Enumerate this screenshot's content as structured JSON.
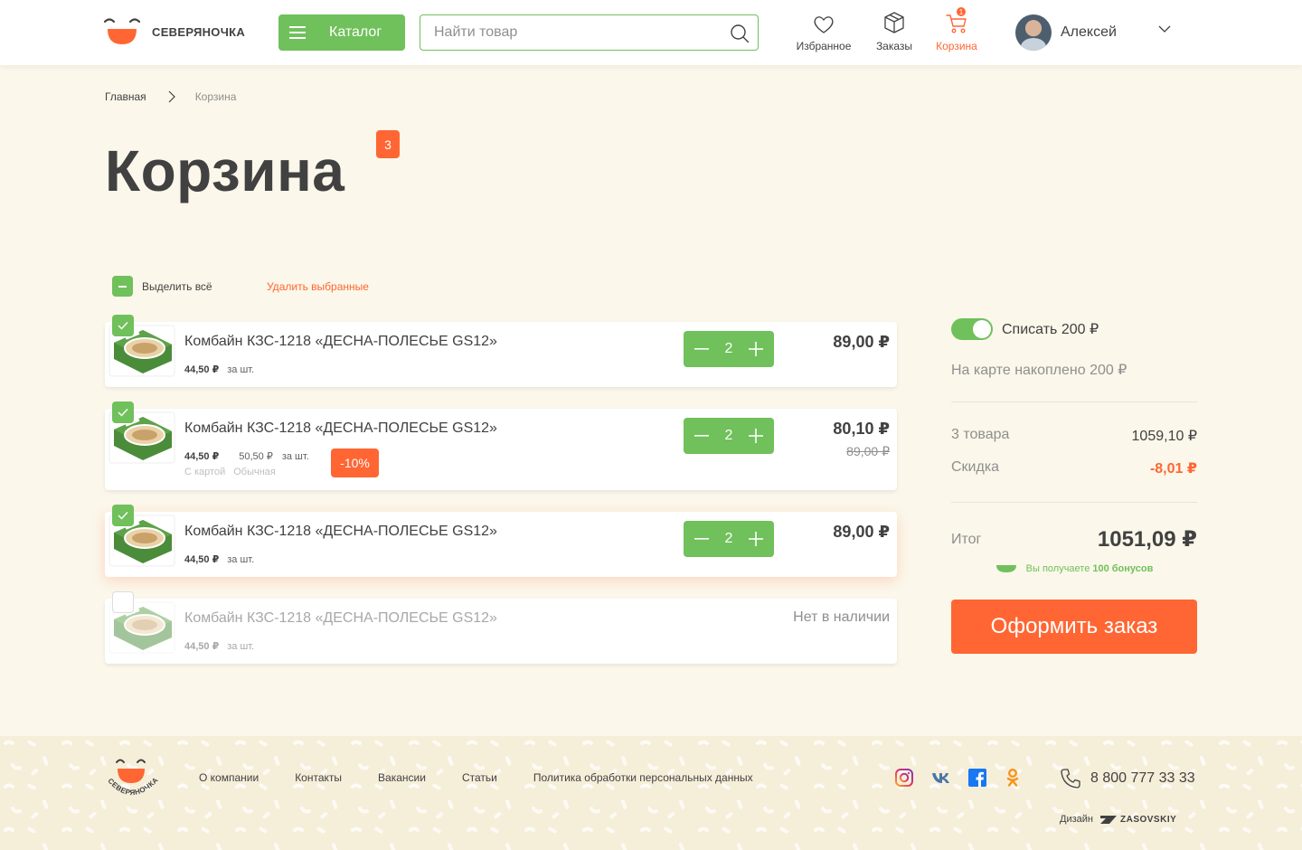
{
  "header": {
    "logo_text": "СЕВЕРЯНОЧКА",
    "catalog_label": "Каталог",
    "search_placeholder": "Найти товар",
    "nav": {
      "favorites": "Избранное",
      "orders": "Заказы",
      "cart": "Корзина",
      "cart_count": "1"
    },
    "user_name": "Алексей"
  },
  "breadcrumb": {
    "home": "Главная",
    "current": "Корзина"
  },
  "page": {
    "title": "Корзина",
    "count": "3"
  },
  "selection": {
    "select_all": "Выделить всё",
    "delete_selected": "Удалить выбранные"
  },
  "items": [
    {
      "name": "Комбайн КЗС-1218 «ДЕСНА-ПОЛЕСЬЕ GS12»",
      "price": "44,50 ₽",
      "per": "за шт.",
      "qty": "2",
      "total": "89,00 ₽",
      "checked": true
    },
    {
      "name": "Комбайн КЗС-1218 «ДЕСНА-ПОЛЕСЬЕ GS12»",
      "price": "44,50 ₽",
      "price_regular": "50,50 ₽",
      "per": "за шт.",
      "label_card": "С картой",
      "label_regular": "Обычная",
      "discount": "-10%",
      "qty": "2",
      "total": "80,10 ₽",
      "old_total": "89,00 ₽",
      "checked": true
    },
    {
      "name": "Комбайн КЗС-1218 «ДЕСНА-ПОЛЕСЬЕ GS12»",
      "price": "44,50 ₽",
      "per": "за шт.",
      "qty": "2",
      "total": "89,00 ₽",
      "checked": true
    },
    {
      "name": "Комбайн КЗС-1218 «ДЕСНА-ПОЛЕСЬЕ GS12»",
      "price": "44,50 ₽",
      "per": "за шт.",
      "status": "Нет в наличии",
      "checked": false
    }
  ],
  "summary": {
    "toggle_label": "Списать 200 ₽",
    "accumulated": "На карте накоплено 200 ₽",
    "goods_label": "3 товара",
    "goods_value": "1059,10 ₽",
    "discount_label": "Скидка",
    "discount_value": "-8,01 ₽",
    "total_label": "Итог",
    "total_value": "1051,09 ₽",
    "bonus_text": "Вы получаете",
    "bonus_value": "100 бонусов",
    "order_button": "Оформить заказ"
  },
  "footer": {
    "logo_text": "СЕВЕРЯНОЧКА",
    "links": [
      "О компании",
      "Контакты",
      "Вакансии",
      "Статьи",
      "Политика обработки персональных данных"
    ],
    "phone": "8 800 777 33 33",
    "design_label": "Дизайн",
    "design_brand": "ZASOVSKIY"
  },
  "colors": {
    "accent_green": "#70c05b",
    "accent_orange": "#ff6633",
    "background": "#fbf7ea",
    "text": "#414141"
  }
}
